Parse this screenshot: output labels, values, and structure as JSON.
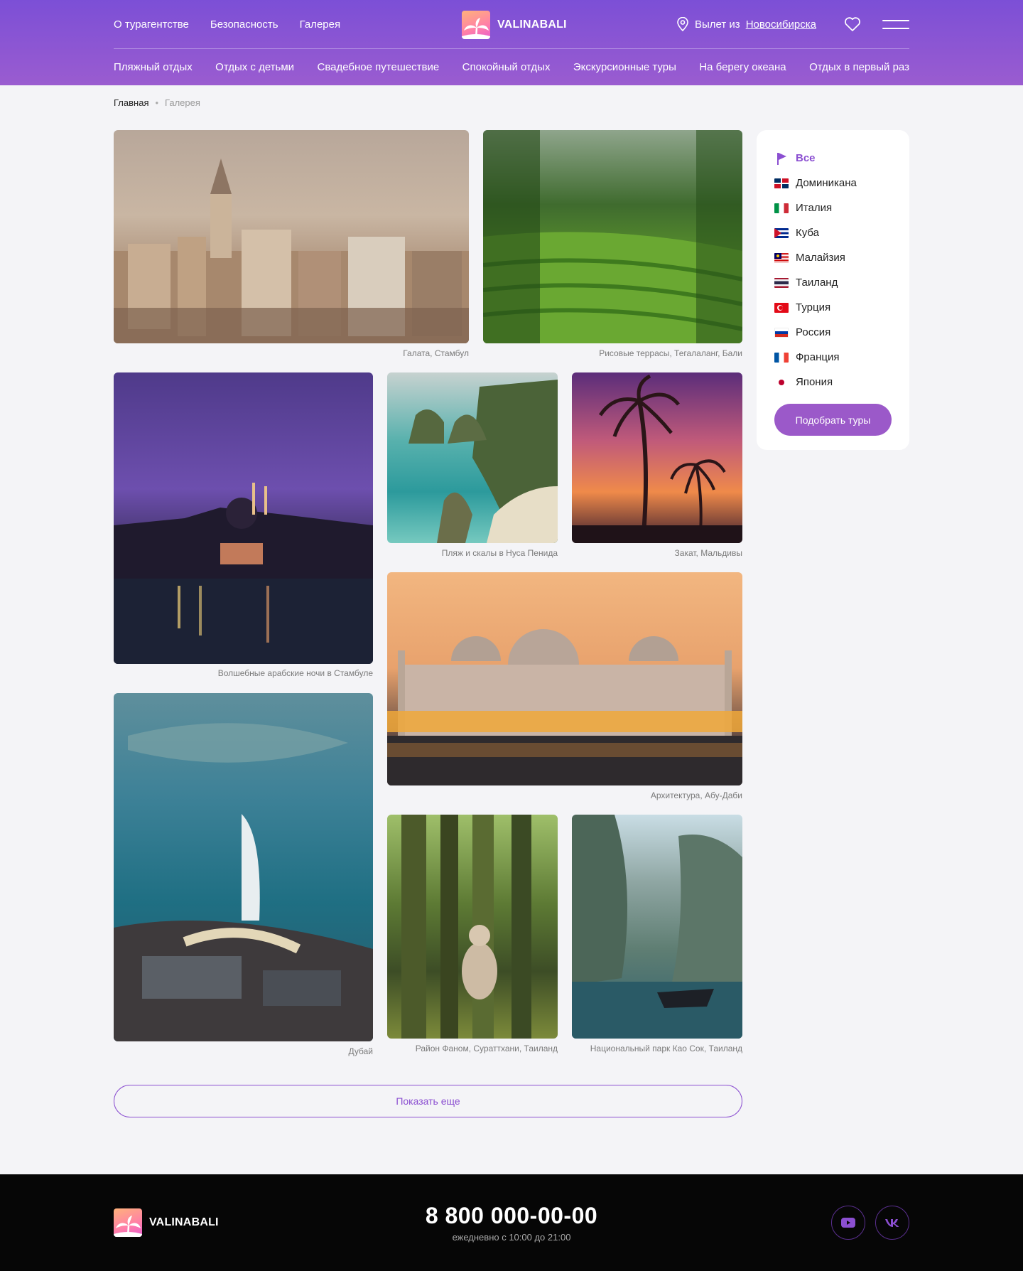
{
  "header": {
    "top_nav": [
      "О турагентстве",
      "Безопасность",
      "Галерея"
    ],
    "logo_text": "VALINABALI",
    "depart_prefix": "Вылет из",
    "depart_city": "Новосибирска",
    "categories": [
      "Пляжный отдых",
      "Отдых с детьми",
      "Свадебное путешествие",
      "Спокойный отдых",
      "Экскурсионные туры",
      "На берегу океана",
      "Отдых в первый раз"
    ]
  },
  "breadcrumb": {
    "home": "Главная",
    "separator": "•",
    "current": "Галерея"
  },
  "gallery": [
    {
      "caption": "Галата, Стамбул"
    },
    {
      "caption": "Рисовые террасы, Тегалаланг, Бали"
    },
    {
      "caption": "Волшебные арабские ночи в Стамбуле"
    },
    {
      "caption": "Пляж и скалы в Нуса Пенида"
    },
    {
      "caption": "Закат, Мальдивы"
    },
    {
      "caption": "Архитектура, Абу-Даби"
    },
    {
      "caption": "Дубай"
    },
    {
      "caption": "Район Фаном, Сураттхани, Таиланд"
    },
    {
      "caption": "Национальный парк Као Сок, Таиланд"
    }
  ],
  "filter": {
    "items": [
      {
        "label": "Все",
        "icon": "flag-icon"
      },
      {
        "label": "Доминикана",
        "icon": "flag-dominican-icon"
      },
      {
        "label": "Италия",
        "icon": "flag-italy-icon"
      },
      {
        "label": "Куба",
        "icon": "flag-cuba-icon"
      },
      {
        "label": "Малайзия",
        "icon": "flag-malaysia-icon"
      },
      {
        "label": "Таиланд",
        "icon": "flag-thailand-icon"
      },
      {
        "label": "Турция",
        "icon": "flag-turkey-icon"
      },
      {
        "label": "Россия",
        "icon": "flag-russia-icon"
      },
      {
        "label": "Франция",
        "icon": "flag-france-icon"
      },
      {
        "label": "Япония",
        "icon": "flag-japan-icon"
      }
    ],
    "button": "Подобрать туры"
  },
  "show_more": "Показать еще",
  "footer": {
    "logo_text": "VALINABALI",
    "phone": "8 800 000-00-00",
    "hours": "ежедневно с 10:00 до 21:00",
    "social": [
      "youtube-icon",
      "vk-icon"
    ]
  },
  "colors": {
    "accent": "#8b4fd1",
    "header_start": "#7c4fd6",
    "header_end": "#9a5cd0",
    "footer_bg": "#060606"
  }
}
